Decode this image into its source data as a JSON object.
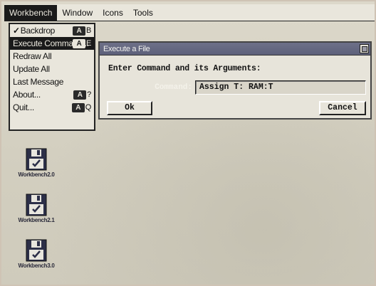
{
  "menubar": {
    "items": [
      {
        "label": "Workbench",
        "active": true
      },
      {
        "label": "Window",
        "active": false
      },
      {
        "label": "Icons",
        "active": false
      },
      {
        "label": "Tools",
        "active": false
      }
    ]
  },
  "workbench_menu": {
    "items": [
      {
        "label": "Backdrop",
        "checkmark": "✓",
        "key_icon": "A",
        "key": "B"
      },
      {
        "label": "Execute Command...",
        "key_icon": "A",
        "key": "E",
        "highlighted": true
      },
      {
        "label": "Redraw All"
      },
      {
        "label": "Update All"
      },
      {
        "label": "Last Message"
      },
      {
        "label": "About...",
        "key_icon": "A",
        "key": "?"
      },
      {
        "label": "Quit...",
        "key_icon": "A",
        "key": "Q"
      }
    ]
  },
  "execute_window": {
    "title": "Execute a File",
    "heading": "Enter Command and its Arguments:",
    "command_label": "Command:",
    "command_value": "Assign T: RAM:T",
    "ok_label": "Ok",
    "cancel_label": "Cancel"
  },
  "desktop_icons": [
    {
      "label": "Workbench2.0",
      "icon": "floppy-disk-icon"
    },
    {
      "label": "Workbench2.1",
      "icon": "floppy-disk-icon"
    },
    {
      "label": "Workbench3.0",
      "icon": "floppy-disk-icon"
    }
  ],
  "colors": {
    "desktop": "#d4d0c2",
    "menu_bg": "#e9e6dc",
    "titlebar": "#5d607a",
    "highlight": "#1a1a1a"
  }
}
